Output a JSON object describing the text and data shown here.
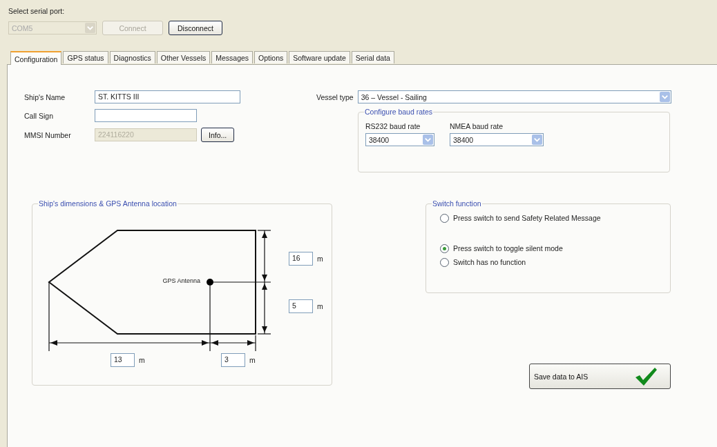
{
  "serial_port": {
    "label": "Select serial port:",
    "port": {
      "value": "COM5",
      "disabled": true
    },
    "buttons": [
      {
        "label": "Connect",
        "disabled": true
      },
      {
        "label": "Disconnect",
        "disabled": false
      }
    ]
  },
  "tabs": [
    {
      "label": "Configuration",
      "selected": true
    },
    {
      "label": "GPS status",
      "selected": false
    },
    {
      "label": "Diagnostics",
      "selected": false
    },
    {
      "label": "Other Vessels",
      "selected": false
    },
    {
      "label": "Messages",
      "selected": false
    },
    {
      "label": "Options",
      "selected": false
    },
    {
      "label": "Software update",
      "selected": false
    },
    {
      "label": "Serial data",
      "selected": false
    }
  ],
  "identity": [
    {
      "label": "Ship's Name",
      "value": "ST. KITTS III",
      "disabled": false
    },
    {
      "label": "Call Sign",
      "disabled": false
    },
    {
      "label": "MMSI Number",
      "value": "224116220",
      "disabled": true
    }
  ],
  "info_button": "Info...",
  "vessel_type": {
    "label": "Vessel type",
    "value": "36 ‒ Vessel - Sailing"
  },
  "baud_rates": {
    "legend": "Configure baud rates",
    "fields": [
      {
        "label": "RS232 baud rate",
        "value": "38400"
      },
      {
        "label": "NMEA baud rate",
        "value": "38400"
      }
    ]
  },
  "dimensions": {
    "legend": "Ship's dimensions & GPS Antenna location",
    "antenna_label": "GPS Antenna",
    "fields": [
      {
        "value": "16",
        "unit": "m"
      },
      {
        "value": "5",
        "unit": "m"
      },
      {
        "value": "13",
        "unit": "m"
      },
      {
        "value": "3",
        "unit": "m"
      }
    ]
  },
  "switch_function": {
    "legend": "Switch function",
    "options": [
      {
        "label": "Press switch to send Safety Related Message",
        "selected": false
      },
      {
        "label": "Press switch to toggle silent mode",
        "selected": true
      },
      {
        "label": "Switch has no function",
        "selected": false
      }
    ]
  },
  "save_button": "Save data to AIS"
}
